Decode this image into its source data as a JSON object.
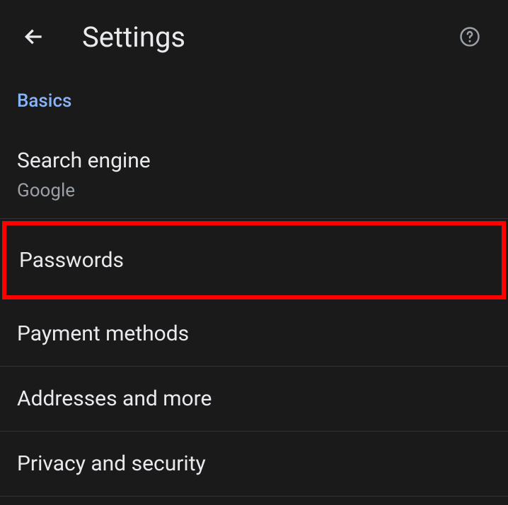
{
  "header": {
    "title": "Settings"
  },
  "section": {
    "label": "Basics"
  },
  "items": [
    {
      "title": "Search engine",
      "subtitle": "Google",
      "highlighted": false
    },
    {
      "title": "Passwords",
      "subtitle": null,
      "highlighted": true
    },
    {
      "title": "Payment methods",
      "subtitle": null,
      "highlighted": false
    },
    {
      "title": "Addresses and more",
      "subtitle": null,
      "highlighted": false
    },
    {
      "title": "Privacy and security",
      "subtitle": null,
      "highlighted": false
    }
  ]
}
